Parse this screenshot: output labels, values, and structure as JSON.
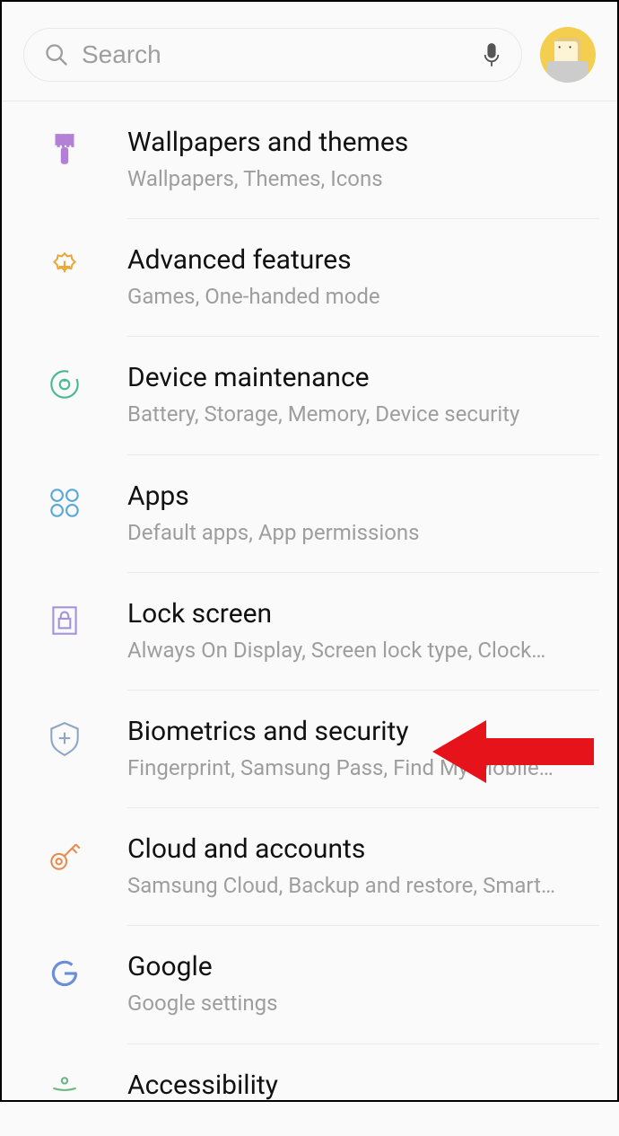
{
  "search": {
    "placeholder": "Search"
  },
  "items": [
    {
      "title": "Wallpapers and themes",
      "sub": "Wallpapers, Themes, Icons"
    },
    {
      "title": "Advanced features",
      "sub": "Games, One-handed mode"
    },
    {
      "title": "Device maintenance",
      "sub": "Battery, Storage, Memory, Device security"
    },
    {
      "title": "Apps",
      "sub": "Default apps, App permissions"
    },
    {
      "title": "Lock screen",
      "sub": "Always On Display, Screen lock type, Clock…"
    },
    {
      "title": "Biometrics and security",
      "sub": "Fingerprint, Samsung Pass, Find My Mobile…"
    },
    {
      "title": "Cloud and accounts",
      "sub": "Samsung Cloud, Backup and restore, Smart…"
    },
    {
      "title": "Google",
      "sub": "Google settings"
    },
    {
      "title": "Accessibility",
      "sub": ""
    }
  ]
}
